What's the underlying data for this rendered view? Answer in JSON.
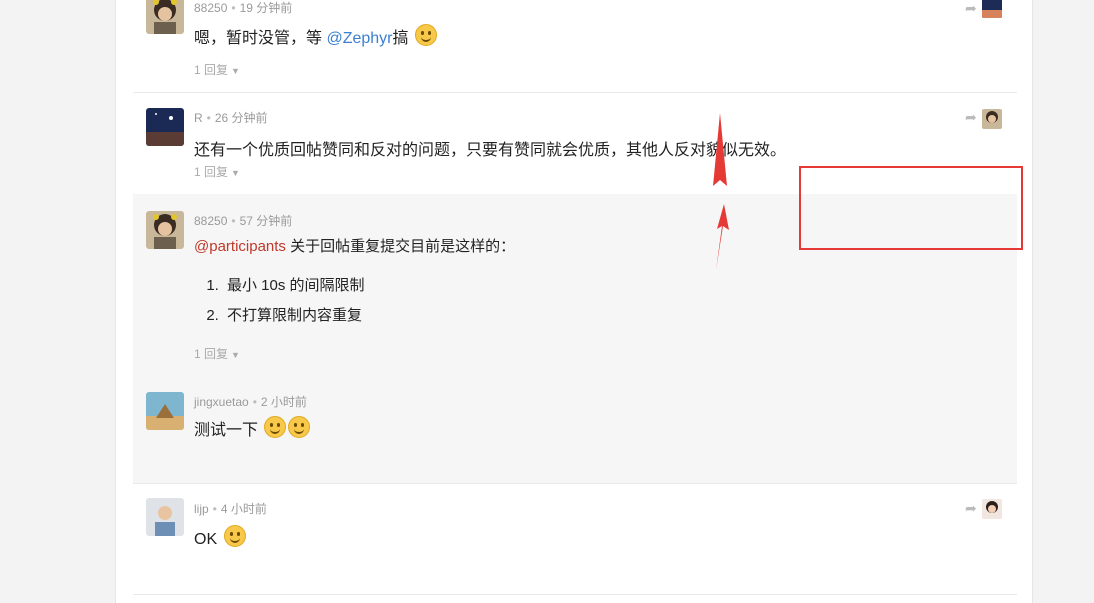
{
  "posts": [
    {
      "user": "88250",
      "time": "19 分钟前",
      "text_prefix": "嗯，暂时没管，等 ",
      "mention": "@Zephyr",
      "text_suffix": "搞",
      "replies": "1 回复",
      "emoji": "smirk-emoji",
      "avatar": "avatar-88250"
    },
    {
      "user": "R",
      "time": "26 分钟前",
      "text": "还有一个优质回帖赞同和反对的问题，只要有赞同就会优质，其他人反对貌似无效。",
      "replies": "1 回复",
      "avatar": "avatar-r"
    },
    {
      "user": "88250",
      "time": "57 分钟前",
      "mention": "@participants",
      "text_suffix": " 关于回帖重复提交目前是这样的：",
      "list": [
        "最小 10s 的间隔限制",
        "不打算限制内容重复"
      ],
      "replies": "1 回复",
      "avatar": "avatar-88250"
    },
    {
      "user": "jingxuetao",
      "time": "2 小时前",
      "text": "测试一下",
      "emoji": "grin-emoji",
      "avatar": "avatar-jingxuetao"
    },
    {
      "user": "lijp",
      "time": "4 小时前",
      "text": "OK",
      "emoji": "smile-emoji",
      "avatar": "avatar-lijp"
    }
  ],
  "icons": {
    "share": "share-arrow-icon",
    "caret": "caret-down-icon"
  },
  "colors": {
    "mention": "#3d7fcf",
    "group_mention": "#c0392b",
    "annotation": "#e53935"
  }
}
